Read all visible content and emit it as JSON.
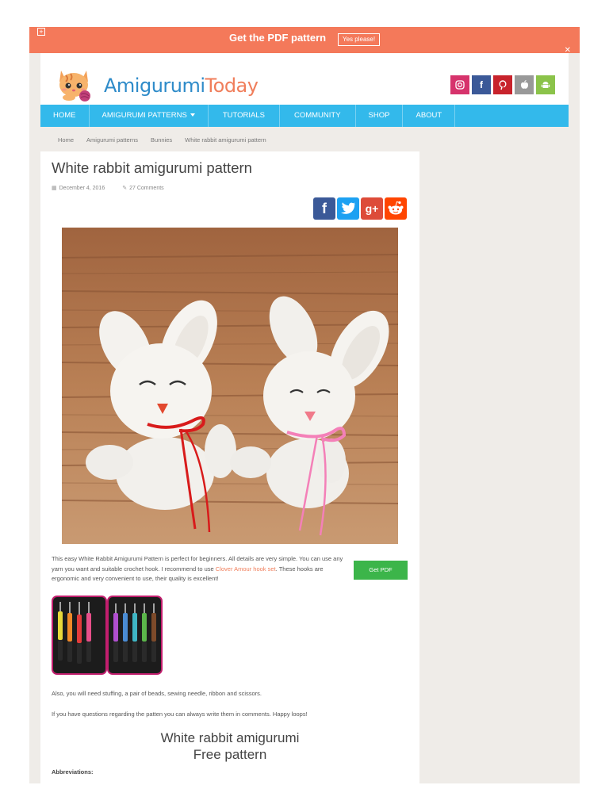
{
  "pdf_bar": {
    "text": "Get the PDF pattern",
    "button": "Yes please!"
  },
  "logo": {
    "part1": "Amigurumi",
    "part2": "Today"
  },
  "social_icons": [
    "instagram-icon",
    "facebook-icon",
    "pinterest-icon",
    "apple-icon",
    "android-icon"
  ],
  "nav": [
    "HOME",
    "AMIGURUMI PATTERNS",
    "TUTORIALS",
    "COMMUNITY",
    "SHOP",
    "ABOUT"
  ],
  "breadcrumb": [
    "Home",
    "Amigurumi patterns",
    "Bunnies",
    "White rabbit amigurumi pattern"
  ],
  "article": {
    "title": "White rabbit amigurumi pattern",
    "date": "December 4, 2016",
    "comments": "27 Comments",
    "intro_1": "This easy White Rabbit Amigurumi Pattern is perfect for beginners. All details are very simple. You can use any yarn you want and suitable crochet hook. I recommend to use ",
    "intro_link": "Clover Amour hook set",
    "intro_2": ". These hooks are ergonomic and very convenient to use, their quality is excellent!",
    "get_pdf": "Get PDF",
    "para_1": "Also, you will need stuffing, a pair of beads, sewing needle, ribbon and scissors.",
    "para_2": "If you have questions regarding the patten you can always write them in comments. Happy loops!",
    "free_title_1": "White rabbit amigurumi",
    "free_title_2": "Free pattern",
    "abbreviations": "Abbreviations:"
  },
  "colors": {
    "pdf_bar": "#f4795a",
    "nav": "#33b9eb",
    "get_pdf": "#3cb54a",
    "link": "#f07e5b"
  }
}
